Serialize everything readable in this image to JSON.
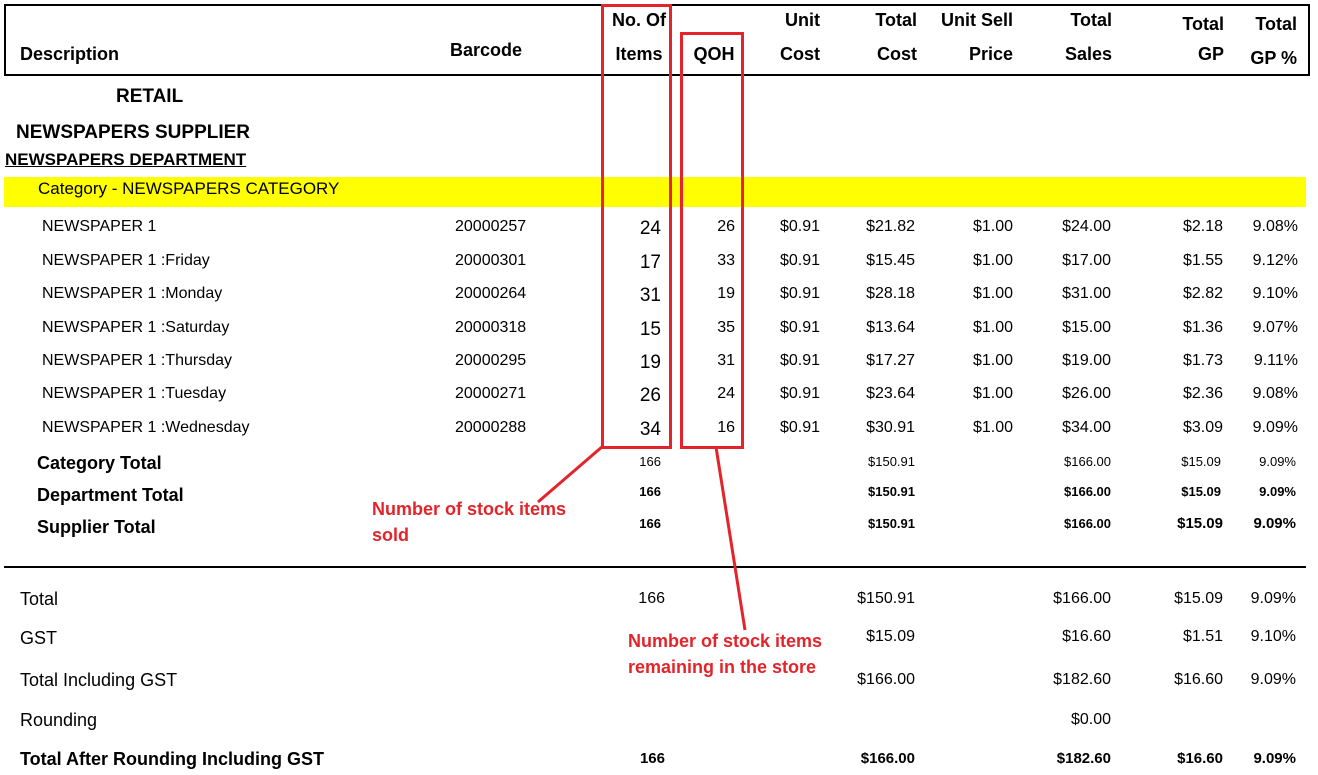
{
  "header": {
    "description": "Description",
    "barcode": "Barcode",
    "no_of_items_1": "No. Of",
    "no_of_items_2": "Items",
    "qoh": "QOH",
    "unit_cost_1": "Unit",
    "unit_cost_2": "Cost",
    "total_cost_1": "Total",
    "total_cost_2": "Cost",
    "unit_sell_1": "Unit Sell",
    "unit_sell_2": "Price",
    "total_sales_1": "Total",
    "total_sales_2": "Sales",
    "total_gp_1": "Total",
    "total_gp_2": "GP",
    "total_gp_pct_1": "Total",
    "total_gp_pct_2": "GP %"
  },
  "groups": {
    "retail": "RETAIL",
    "supplier": "NEWSPAPERS SUPPLIER",
    "department": "NEWSPAPERS DEPARTMENT",
    "category": "Category - NEWSPAPERS CATEGORY"
  },
  "rows": [
    {
      "desc": "NEWSPAPER 1",
      "barcode": "20000257",
      "items": "24",
      "qoh": "26",
      "unit_cost": "$0.91",
      "total_cost": "$21.82",
      "unit_sell": "$1.00",
      "total_sales": "$24.00",
      "gp": "$2.18",
      "gp_pct": "9.08%"
    },
    {
      "desc": "NEWSPAPER 1 :Friday",
      "barcode": "20000301",
      "items": "17",
      "qoh": "33",
      "unit_cost": "$0.91",
      "total_cost": "$15.45",
      "unit_sell": "$1.00",
      "total_sales": "$17.00",
      "gp": "$1.55",
      "gp_pct": "9.12%"
    },
    {
      "desc": "NEWSPAPER 1 :Monday",
      "barcode": "20000264",
      "items": "31",
      "qoh": "19",
      "unit_cost": "$0.91",
      "total_cost": "$28.18",
      "unit_sell": "$1.00",
      "total_sales": "$31.00",
      "gp": "$2.82",
      "gp_pct": "9.10%"
    },
    {
      "desc": "NEWSPAPER 1 :Saturday",
      "barcode": "20000318",
      "items": "15",
      "qoh": "35",
      "unit_cost": "$0.91",
      "total_cost": "$13.64",
      "unit_sell": "$1.00",
      "total_sales": "$15.00",
      "gp": "$1.36",
      "gp_pct": "9.07%"
    },
    {
      "desc": "NEWSPAPER 1 :Thursday",
      "barcode": "20000295",
      "items": "19",
      "qoh": "31",
      "unit_cost": "$0.91",
      "total_cost": "$17.27",
      "unit_sell": "$1.00",
      "total_sales": "$19.00",
      "gp": "$1.73",
      "gp_pct": "9.11%"
    },
    {
      "desc": "NEWSPAPER 1 :Tuesday",
      "barcode": "20000271",
      "items": "26",
      "qoh": "24",
      "unit_cost": "$0.91",
      "total_cost": "$23.64",
      "unit_sell": "$1.00",
      "total_sales": "$26.00",
      "gp": "$2.36",
      "gp_pct": "9.08%"
    },
    {
      "desc": "NEWSPAPER 1 :Wednesday",
      "barcode": "20000288",
      "items": "34",
      "qoh": "16",
      "unit_cost": "$0.91",
      "total_cost": "$30.91",
      "unit_sell": "$1.00",
      "total_sales": "$34.00",
      "gp": "$3.09",
      "gp_pct": "9.09%"
    }
  ],
  "subtotals": {
    "category": {
      "label": "Category Total",
      "items": "166",
      "total_cost": "$150.91",
      "total_sales": "$166.00",
      "gp": "$15.09",
      "gp_pct": "9.09%"
    },
    "department": {
      "label": "Department Total",
      "items": "166",
      "total_cost": "$150.91",
      "total_sales": "$166.00",
      "gp": "$15.09",
      "gp_pct": "9.09%"
    },
    "supplier": {
      "label": "Supplier Total",
      "items": "166",
      "total_cost": "$150.91",
      "total_sales": "$166.00",
      "gp": "$15.09",
      "gp_pct": "9.09%"
    }
  },
  "totals": {
    "total": {
      "label": "Total",
      "items": "166",
      "total_cost": "$150.91",
      "total_sales": "$166.00",
      "gp": "$15.09",
      "gp_pct": "9.09%"
    },
    "gst": {
      "label": "GST",
      "total_cost": "$15.09",
      "total_sales": "$16.60",
      "gp": "$1.51",
      "gp_pct": "9.10%"
    },
    "incl_gst": {
      "label": "Total Including GST",
      "total_cost": "$166.00",
      "total_sales": "$182.60",
      "gp": "$16.60",
      "gp_pct": "9.09%"
    },
    "rounding": {
      "label": "Rounding",
      "total_sales": "$0.00"
    },
    "after_rounding": {
      "label": "Total After Rounding Including GST",
      "items": "166",
      "total_cost": "$166.00",
      "total_sales": "$182.60",
      "gp": "$16.60",
      "gp_pct": "9.09%"
    }
  },
  "annotations": {
    "sold_line1": "Number of stock items",
    "sold_line2": "sold",
    "remaining_line1": "Number of stock items",
    "remaining_line2": "remaining in the store"
  },
  "colors": {
    "highlight": "#ffff00",
    "annotation": "#e3242b"
  }
}
